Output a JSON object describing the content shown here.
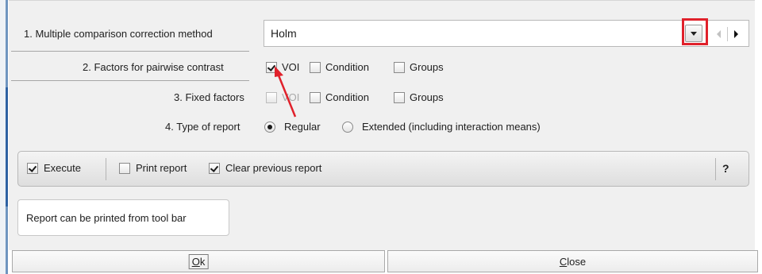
{
  "form": {
    "method_label": "1. Multiple comparison correction method",
    "method_value": "Holm",
    "factors_pairwise_label": "2. Factors for pairwise contrast",
    "fixed_factors_label": "3. Fixed factors",
    "report_type_label": "4. Type of report",
    "pairwise": [
      {
        "label": "VOI",
        "checked": true
      },
      {
        "label": "Condition",
        "checked": false
      },
      {
        "label": "Groups",
        "checked": false
      }
    ],
    "fixed": [
      {
        "label": "VOI",
        "checked": false,
        "disabled": true
      },
      {
        "label": "Condition",
        "checked": false
      },
      {
        "label": "Groups",
        "checked": false
      }
    ],
    "report_types": [
      {
        "label": "Regular",
        "selected": true
      },
      {
        "label": "Extended (including interaction means)",
        "selected": false
      }
    ]
  },
  "execution": {
    "execute": {
      "label": "Execute",
      "checked": true
    },
    "print_report": {
      "label": "Print report",
      "checked": false
    },
    "clear_previous": {
      "label": "Clear previous report",
      "checked": true
    },
    "help_label": "?"
  },
  "tooltip": {
    "text": "Report can be printed from tool bar"
  },
  "buttons": {
    "ok": {
      "mnemonic": "O",
      "rest": "k"
    },
    "close": {
      "mnemonic": "C",
      "rest": "lose"
    }
  },
  "annotations": {
    "highlight_color": "#e0212b",
    "arrow_color": "#e0212b"
  },
  "icons": {
    "dropdown": "chevron-down-icon",
    "prev": "previous-icon",
    "next": "next-icon"
  }
}
